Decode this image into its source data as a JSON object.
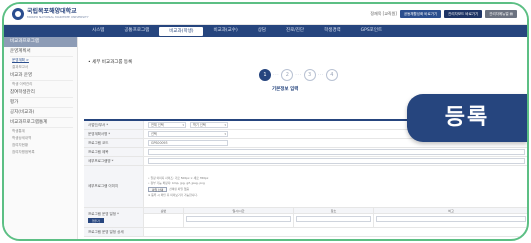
{
  "header": {
    "logo_title": "국립목포해양대학교",
    "logo_sub": "MOKPO NATIONAL MARITIME UNIVERSITY",
    "util_text": "정재욱 [교직원]",
    "util_buttons": [
      "공동체활성화 바로가기",
      "관리자모드 바로가기",
      "관리자메뉴얼 ▤"
    ]
  },
  "nav": {
    "items": [
      "시스템",
      "공통프로그램",
      "비교과(학생)",
      "비교과(교수)",
      "상담",
      "진로/진단",
      "학생경력",
      "GPS포인트"
    ],
    "active_index": 2
  },
  "sidebar": {
    "title": "비교과프로그램",
    "groups": [
      {
        "label": "운영계획서",
        "subs": [
          "운영계획 >",
          "결과보고서"
        ],
        "active_sub": 0
      },
      {
        "label": "비교과 운영",
        "subs": [
          "학생 이력관리"
        ],
        "active_sub": -1
      },
      {
        "label": "참여학생관리",
        "subs": [],
        "active_sub": -1
      },
      {
        "label": "평가",
        "subs": [],
        "active_sub": -1
      },
      {
        "label": "공지(비교과)",
        "subs": [],
        "active_sub": -1
      },
      {
        "label": "비교과프로그램통계",
        "subs": [
          "학생통계",
          "학생상세내역",
          "참여자현황",
          "참여자평점목록"
        ],
        "active_sub": -1
      }
    ]
  },
  "main": {
    "page_title": "• 세부 비교과그룹 등록",
    "steps": [
      "1",
      "2",
      "3",
      "4"
    ],
    "active_step": 0,
    "step_label": "기본정보 입력",
    "mini_buttons": [
      "목록보기",
      "저장",
      "취소"
    ],
    "form": {
      "rows": [
        {
          "label": "사업단/부서 *",
          "select1": "전체 선택",
          "select2": "학기 선택"
        },
        {
          "label": "운영계획서명 *",
          "select_wide": "선택"
        },
        {
          "label": "프로그램 코드",
          "input": "GPS00093"
        },
        {
          "label": "프로그램 제목",
          "input": ""
        },
        {
          "label": "세부프로그램명 *",
          "input": ""
        }
      ],
      "attach": {
        "label": "세부프로그램 이미지",
        "notes": [
          "• 권장 이미지 사이즈: 가로 500px × 세로 350px",
          "• 첨부 가능 확장자: bmp, jpg, gif, jpeg, png"
        ],
        "button": "파일 선택",
        "file_status": "선택된 파일 없음",
        "warn": "※ 등록 시 확인 후 미리보기가 가능합니다."
      },
      "table_row": {
        "label": "프로그램 운영 일정 *",
        "add_button": "행추가",
        "headers": [
          "순번",
          "일시/시간",
          "장소",
          "비고"
        ]
      },
      "last_label": "프로그램 운영 일정 상세"
    }
  },
  "overlay": {
    "badge_text": "등록",
    "badge_color": "#26457e"
  }
}
